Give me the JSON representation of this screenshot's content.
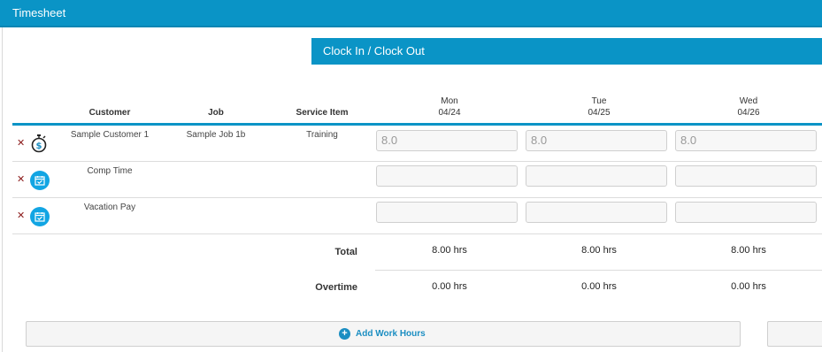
{
  "header": {
    "title": "Timesheet"
  },
  "clock": {
    "label": "Clock In / Clock Out"
  },
  "columns": {
    "customer": "Customer",
    "job": "Job",
    "service_item": "Service Item"
  },
  "days": [
    {
      "name": "Mon",
      "date": "04/24"
    },
    {
      "name": "Tue",
      "date": "04/25"
    },
    {
      "name": "Wed",
      "date": "04/26"
    }
  ],
  "rows": [
    {
      "icon": "stopwatch-dollar-icon",
      "customer": "Sample Customer 1",
      "job": "Sample Job 1b",
      "service_item": "Training",
      "hours": [
        "8.0",
        "8.0",
        "8.0"
      ]
    },
    {
      "icon": "calendar-icon",
      "customer": "Comp Time",
      "job": "",
      "service_item": "",
      "hours": [
        "",
        "",
        ""
      ]
    },
    {
      "icon": "calendar-icon",
      "customer": "Vacation Pay",
      "job": "",
      "service_item": "",
      "hours": [
        "",
        "",
        ""
      ]
    }
  ],
  "summary": {
    "total_label": "Total",
    "overtime_label": "Overtime",
    "totals": [
      "8.00 hrs",
      "8.00 hrs",
      "8.00 hrs"
    ],
    "overtime": [
      "0.00 hrs",
      "0.00 hrs",
      "0.00 hrs"
    ]
  },
  "actions": {
    "add_label": "Add Work Hours"
  },
  "colors": {
    "accent": "#0a94c6",
    "delete": "#8b1a1a",
    "icon_bg": "#12a5e3"
  }
}
